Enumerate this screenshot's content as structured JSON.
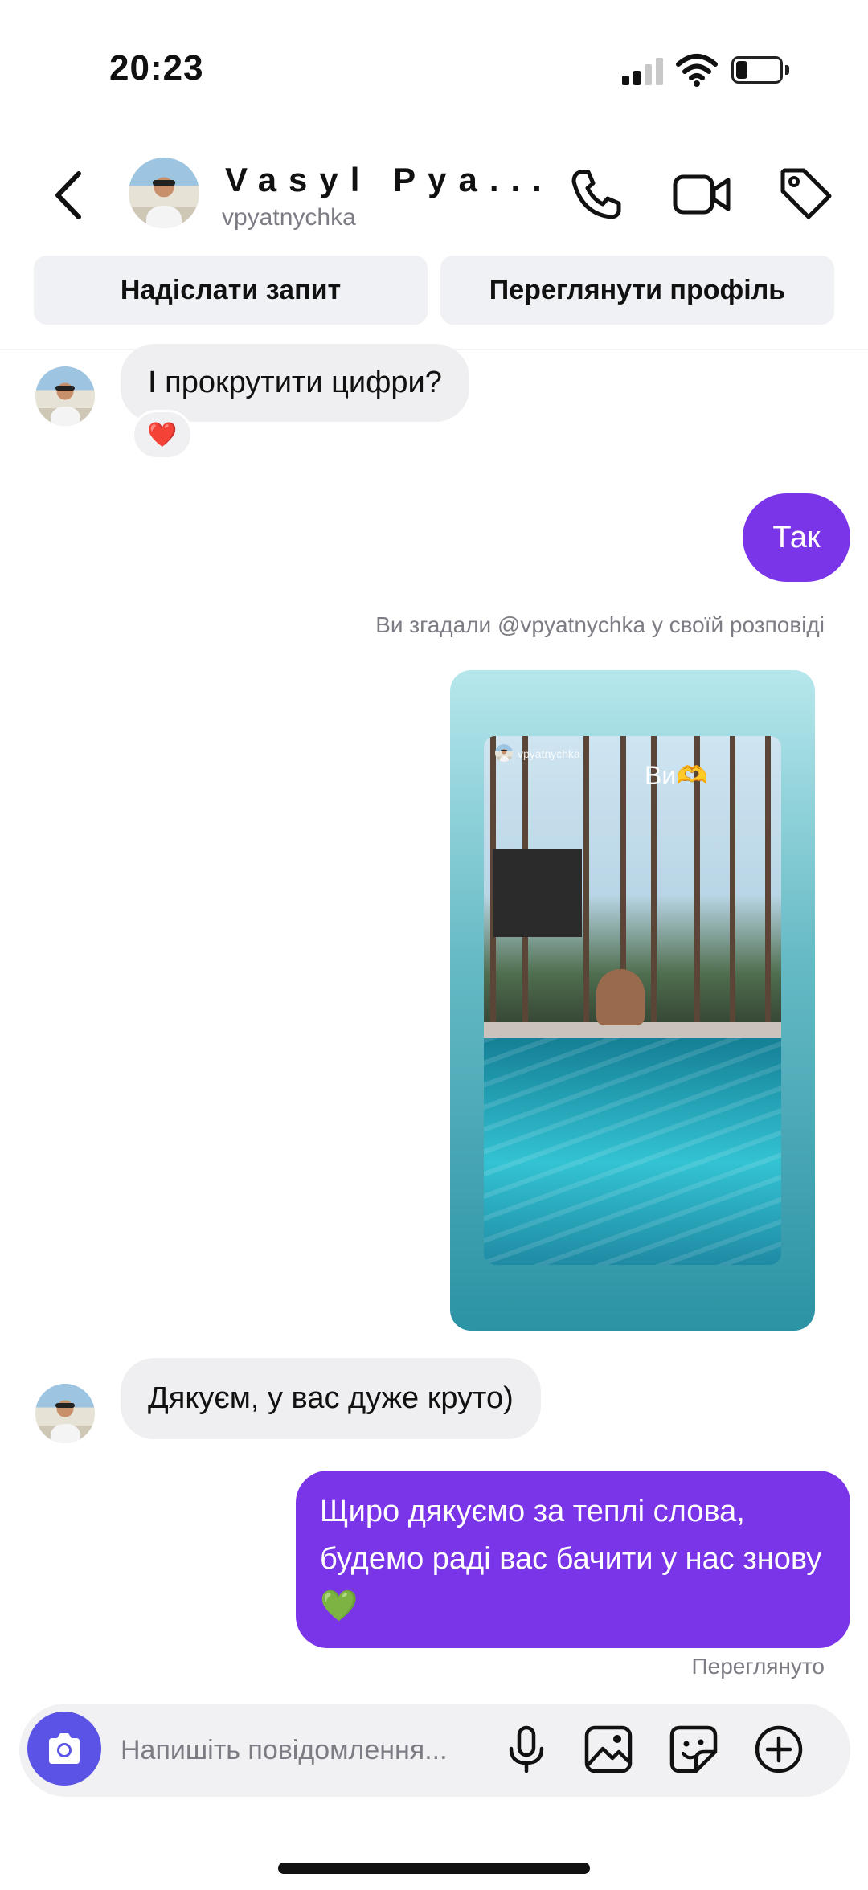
{
  "status_bar": {
    "time": "20:23"
  },
  "header": {
    "name": "Vasyl Pya...",
    "username": "vpyatnychka",
    "icons": [
      "back-icon",
      "phone-icon",
      "video-icon",
      "tag-icon"
    ]
  },
  "actions": {
    "send_request": "Надіслати запит",
    "view_profile": "Переглянути профіль"
  },
  "messages": [
    {
      "from": "them",
      "text": "І прокрутити цифри?",
      "reaction": "❤️"
    },
    {
      "from": "me",
      "text": "Так"
    },
    {
      "from": "system",
      "text": "Ви згадали @vpyatnychka у своїй розповіді"
    },
    {
      "from": "me",
      "type": "story",
      "caption": "Ви🫶",
      "account": "vpyatnychka"
    },
    {
      "from": "them",
      "text": "Дякуєм, у вас дуже круто)"
    },
    {
      "from": "me",
      "text": "Щиро дякуємо за теплі слова, будемо раді вас бачити у нас знову 💚"
    }
  ],
  "seen_label": "Переглянуто",
  "composer": {
    "placeholder": "Напишіть повідомлення...",
    "icons": [
      "camera-icon",
      "microphone-icon",
      "gallery-icon",
      "sticker-icon",
      "plus-icon"
    ]
  },
  "colors": {
    "outgoing_bubble": "#7b35e8",
    "incoming_bubble": "#efeff1",
    "camera_button": "#5a53e6"
  }
}
